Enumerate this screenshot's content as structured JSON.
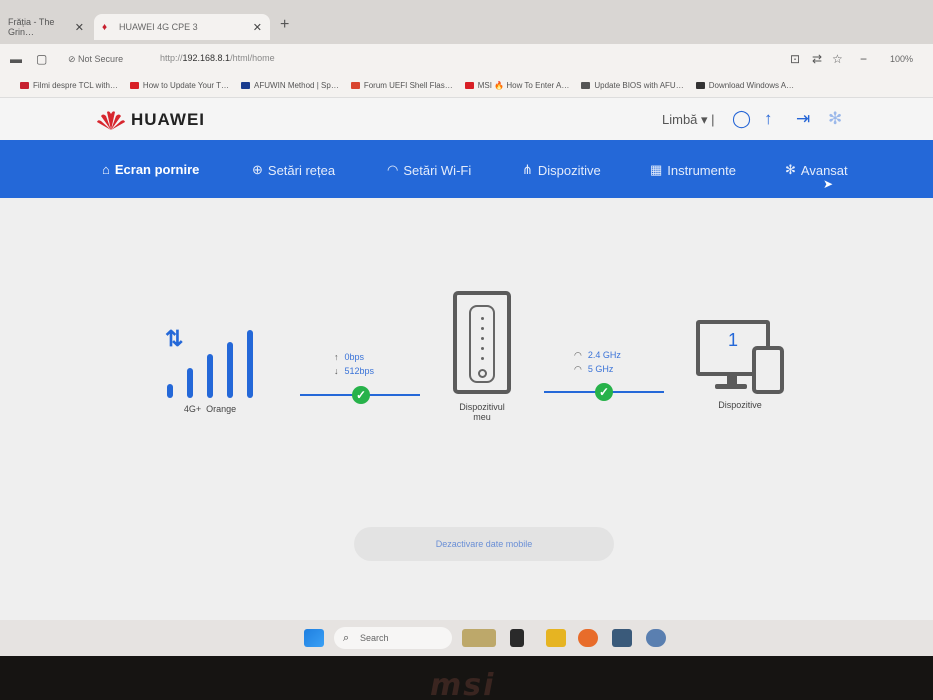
{
  "browser": {
    "tabs": [
      {
        "label": "Frăția - The Grin…"
      },
      {
        "label": "HUAWEI 4G CPE 3"
      }
    ],
    "security_label": "Not Secure",
    "url_host": "192.168.8.1",
    "url_path": "/html/home",
    "zoom": "100%",
    "bookmarks": [
      {
        "label": "Filmi despre TCL with…",
        "color": "#c7202f"
      },
      {
        "label": "How to Update Your T…",
        "color": "#d81f26"
      },
      {
        "label": "AFUWIN Method | Sp…",
        "color": "#1a3d8f"
      },
      {
        "label": "Forum UEFI Shell Flas…",
        "color": "#d9452f"
      },
      {
        "label": "MSI 🔥 How To Enter A…",
        "color": "#d81f26"
      },
      {
        "label": "Update BIOS with AFU…",
        "color": "#555555"
      },
      {
        "label": "Download Windows A…",
        "color": "#333333"
      }
    ]
  },
  "router_ui": {
    "brand": "HUAWEI",
    "language_label": "Limbă",
    "nav": [
      {
        "label": "Ecran pornire",
        "icon": "home-icon"
      },
      {
        "label": "Setări rețea",
        "icon": "globe-icon"
      },
      {
        "label": "Setări Wi-Fi",
        "icon": "wifi-icon"
      },
      {
        "label": "Dispozitive",
        "icon": "devices-icon"
      },
      {
        "label": "Instrumente",
        "icon": "tools-icon"
      },
      {
        "label": "Avansat",
        "icon": "gear-icon"
      }
    ],
    "network": {
      "type": "4G+",
      "operator": "Orange",
      "upload": "0bps",
      "download": "512bps"
    },
    "wifi": {
      "band1": "2.4 GHz",
      "band2": "5 GHz"
    },
    "device_label_line1": "Dispozitivul",
    "device_label_line2": "meu",
    "connected_count": "1",
    "devices_label": "Dispozitive",
    "mobile_data_button": "Dezactivare date mobile",
    "accent_color": "#2468d8",
    "ok_color": "#27b24a"
  },
  "taskbar": {
    "search_placeholder": "Search"
  },
  "laptop_brand": "msi"
}
